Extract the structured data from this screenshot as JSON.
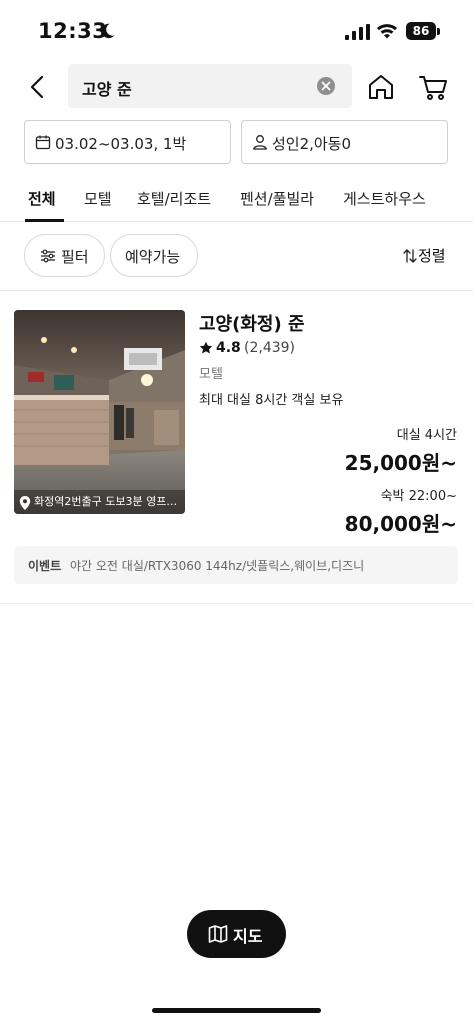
{
  "status_bar": {
    "time": "12:33",
    "battery": "86"
  },
  "header": {
    "search_query": "고양 준"
  },
  "selectors": {
    "date": "03.02~03.03, 1박",
    "guests": "성인2,아동0"
  },
  "tabs": [
    {
      "label": "전체",
      "active": true
    },
    {
      "label": "모텔",
      "active": false
    },
    {
      "label": "호텔/리조트",
      "active": false
    },
    {
      "label": "펜션/풀빌라",
      "active": false
    },
    {
      "label": "게스트하우스",
      "active": false
    }
  ],
  "filters": {
    "filter_label": "필터",
    "available_label": "예약가능",
    "sort_label": "정렬"
  },
  "listing": {
    "name": "고양(화정) 준",
    "rating": "4.8",
    "review_count": "(2,439)",
    "category": "모텔",
    "notice": "최대 대실 8시간 객실 보유",
    "location": "화정역2번출구 도보3분 영프…",
    "rental_label": "대실 4시간",
    "rental_price": "25,000원~",
    "stay_label": "숙박 22:00~",
    "stay_price": "80,000원~",
    "event_tag": "이벤트",
    "event_text": "야간 오전 대실/RTX3060 144hz/넷플릭스,웨이브,디즈니"
  },
  "map_button": {
    "label": "지도"
  },
  "icons": {
    "back": "chevron-left-icon",
    "clear": "clear-circle-icon",
    "home": "home-icon",
    "cart": "cart-icon",
    "calendar": "calendar-icon",
    "person": "person-icon",
    "filter": "sliders-icon",
    "sort": "sort-arrows-icon",
    "star": "star-icon",
    "pin": "map-pin-icon",
    "map": "map-icon"
  },
  "colors": {
    "text": "#111111",
    "muted": "#777777",
    "border": "#cfcfcf",
    "search_bg": "#f2f2f2",
    "event_bg": "#f5f5f5",
    "map_button_bg": "#111111"
  }
}
